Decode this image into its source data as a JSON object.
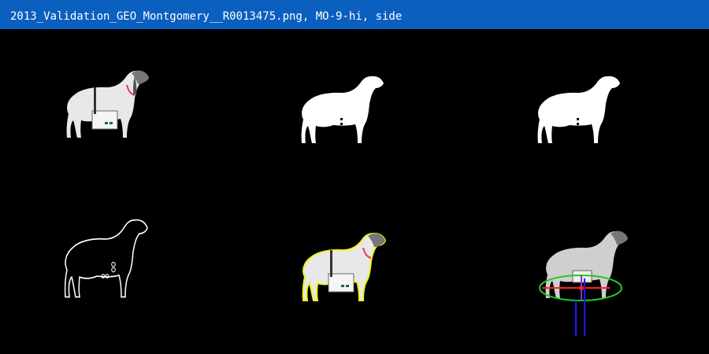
{
  "window": {
    "title": "2013_Validation_GEO_Montgomery__R0013475.png, MO-9-hi, side"
  },
  "panels": [
    {
      "id": "original",
      "icon": "goat-photo-icon"
    },
    {
      "id": "binary-mask",
      "icon": "goat-mask-icon"
    },
    {
      "id": "filled-mask",
      "icon": "goat-mask-icon"
    },
    {
      "id": "contour",
      "icon": "goat-outline-icon"
    },
    {
      "id": "overlay-outline",
      "icon": "goat-overlay-icon"
    },
    {
      "id": "ellipse-fit",
      "icon": "ellipse-fit-icon"
    }
  ],
  "colors": {
    "titlebar": "#0a5fbf",
    "overlay_outline": "#f2f21a",
    "ellipse": "#22cc22",
    "axis_major": "#ff2020",
    "axis_minor": "#8a2be2",
    "legs": "#1a1aff"
  }
}
